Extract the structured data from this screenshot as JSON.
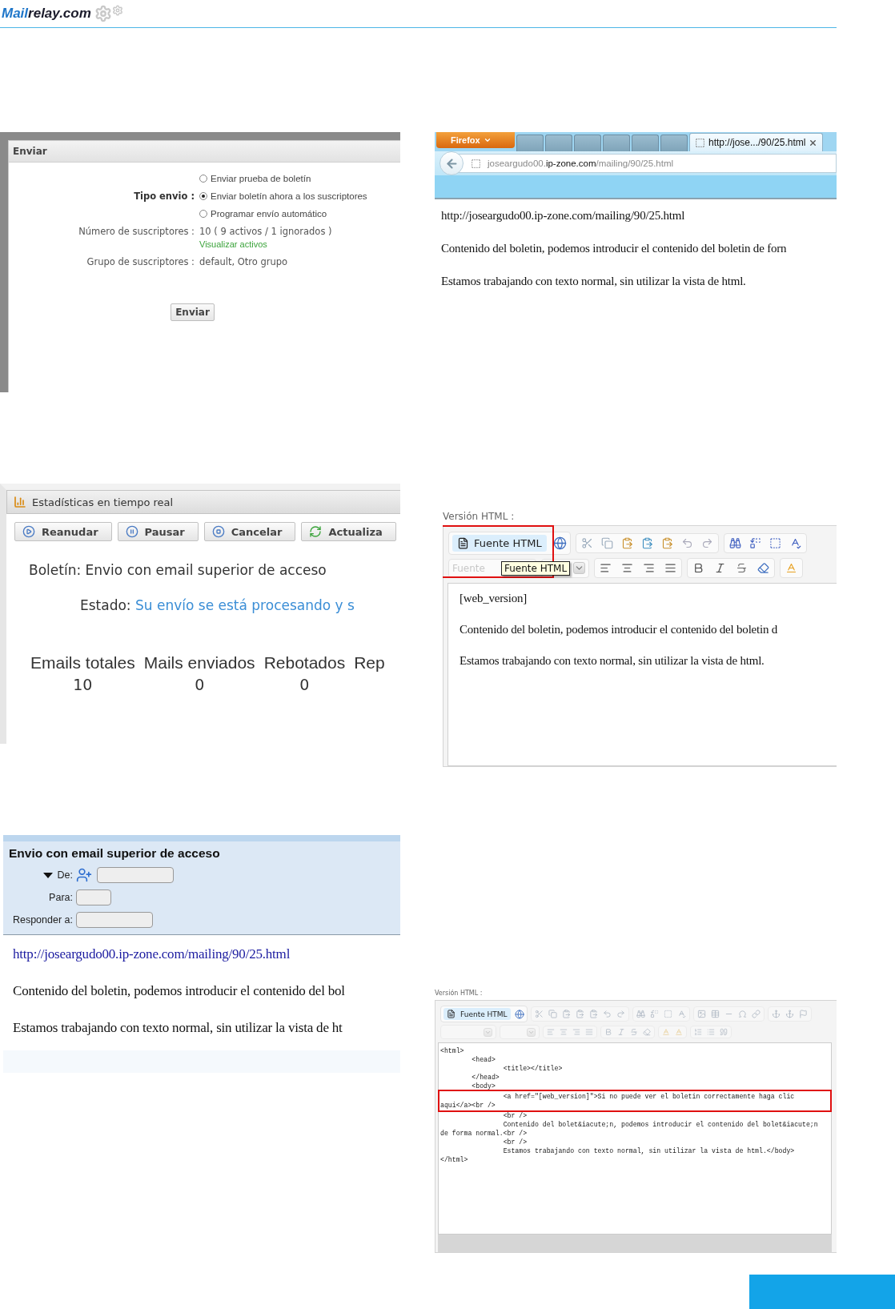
{
  "header": {
    "logo_part_1": "Mail",
    "logo_part_2": "relay.com"
  },
  "send_dialog": {
    "title": "Enviar",
    "send_type_label": "Tipo envio :",
    "options": [
      {
        "label": "Enviar prueba de boletín",
        "selected": false
      },
      {
        "label": "Enviar boletín ahora a los suscriptores",
        "selected": true
      },
      {
        "label": "Programar envío automático",
        "selected": false
      }
    ],
    "subscribers_label": "Número de suscriptores :",
    "subscribers_value": "10 ( 9 activos / 1 ignorados )",
    "view_active_link": "Visualizar activos",
    "group_label": "Grupo de suscriptores :",
    "group_value": "default, Otro grupo",
    "button": "Enviar"
  },
  "browser": {
    "menu_button": "Firefox",
    "tabs": [
      {
        "selected": false
      },
      {
        "selected": false
      },
      {
        "selected": false
      },
      {
        "selected": false
      },
      {
        "selected": false
      },
      {
        "selected": false
      },
      {
        "title": "http://jose.../90/25.html",
        "selected": true
      }
    ],
    "url": "joseargudo00.**ip-zone.com**/mailing/90/25.html",
    "content": [
      "http://joseargudo00.ip-zone.com/mailing/90/25.html",
      "Contenido del boletin, podemos introducir el contenido del boletin de forn",
      "Estamos trabajando con texto normal, sin utilizar la vista de html."
    ]
  },
  "stats": {
    "title": "Estadísticas en tiempo real",
    "buttons": [
      {
        "label": "Reanudar",
        "kind": "play"
      },
      {
        "label": "Pausar",
        "kind": "pause"
      },
      {
        "label": "Cancelar",
        "kind": "stop"
      },
      {
        "label": "Actualiza",
        "kind": "refresh"
      }
    ],
    "newsletter": "Boletín: Envio con email superior de acceso",
    "status_label": "Estado:",
    "status_value": "Su envío se está procesando y s",
    "columns": [
      {
        "label": "Emails totales",
        "value": "10"
      },
      {
        "label": "Mails enviados",
        "value": "0"
      },
      {
        "label": "Rebotados",
        "value": "0"
      },
      {
        "label": "Rep"
      }
    ]
  },
  "rich_editor": {
    "label": "Versión HTML :",
    "source_button": {
      "label": "Fuente HTML",
      "highlighted": true
    },
    "font_placeholder": "Fuente",
    "tooltip": "Fuente HTML",
    "content": [
      "[web_version]",
      "Contenido del boletin, podemos introducir el contenido del boletin d",
      "Estamos trabajando con texto normal, sin utilizar la vista de html."
    ]
  },
  "mail_compose": {
    "subject": "Envio con email superior de acceso",
    "fields": [
      {
        "label": "De:",
        "kind": "from"
      },
      {
        "label": "Para:",
        "kind": "plain"
      },
      {
        "label": "Responder a:",
        "kind": "plain"
      }
    ],
    "link": "http://joseargudo00.ip-zone.com/mailing/90/25.html",
    "paragraphs": [
      "Contenido del boletin, podemos introducir el contenido del bol",
      "Estamos trabajando con texto normal, sin utilizar la vista de ht"
    ]
  },
  "source_editor": {
    "label": "Versión HTML :",
    "source_button": "Fuente HTML",
    "code_lines": [
      {
        "text": "<html>",
        "highlighted": false
      },
      {
        "text": "\t<head>",
        "highlighted": false
      },
      {
        "text": "\t\t<title></title>",
        "highlighted": false
      },
      {
        "text": "\t</head>",
        "highlighted": false
      },
      {
        "text": "\t<body>",
        "highlighted": false
      },
      {
        "text": "\t\t<a href=\"[web_version]\">Si no puede ver el boletin correctamente haga clic aqui</a><br />",
        "highlighted": true
      },
      {
        "text": "\t\t<br />",
        "highlighted": false
      },
      {
        "text": "\t\tContenido del bolet&iacute;n, podemos introducir el contenido del bolet&iacute;n de forma normal.<br />",
        "highlighted": false
      },
      {
        "text": "\t\t<br />",
        "highlighted": false
      },
      {
        "text": "\t\tEstamos trabajando con texto normal, sin utilizar la vista de html.</body>",
        "highlighted": false
      },
      {
        "text": "</html>",
        "highlighted": false
      }
    ]
  }
}
